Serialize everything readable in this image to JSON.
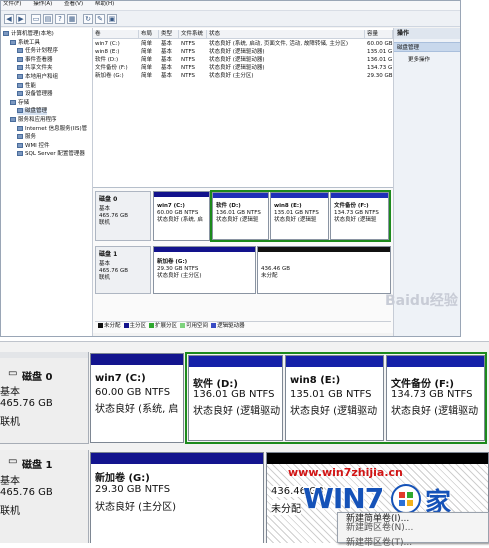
{
  "menu": [
    "文件(F)",
    "操作(A)",
    "查看(V)",
    "帮助(H)"
  ],
  "tree": [
    {
      "label": "计算机管理(本地)",
      "indent": 0
    },
    {
      "label": "系统工具",
      "indent": 1
    },
    {
      "label": "任务计划程序",
      "indent": 2
    },
    {
      "label": "事件查看器",
      "indent": 2
    },
    {
      "label": "共享文件夹",
      "indent": 2
    },
    {
      "label": "本地用户和组",
      "indent": 2
    },
    {
      "label": "性能",
      "indent": 2
    },
    {
      "label": "设备管理器",
      "indent": 2
    },
    {
      "label": "存储",
      "indent": 1
    },
    {
      "label": "磁盘管理",
      "indent": 2
    },
    {
      "label": "服务和应用程序",
      "indent": 1
    },
    {
      "label": "Internet 信息服务(IIS)管",
      "indent": 2
    },
    {
      "label": "服务",
      "indent": 2
    },
    {
      "label": "WMI 控件",
      "indent": 2
    },
    {
      "label": "SQL Server 配置管理器",
      "indent": 2
    }
  ],
  "volume_table": {
    "columns": [
      "卷",
      "布局",
      "类型",
      "文件系统",
      "状态",
      "容量"
    ],
    "rows": [
      [
        "win7 (C:)",
        "简单",
        "基本",
        "NTFS",
        "状态良好 (系统, 启动, 页面文件, 活动, 故障转储, 主分区)",
        "60.00 GB"
      ],
      [
        "win8 (E:)",
        "简单",
        "基本",
        "NTFS",
        "状态良好 (逻辑驱动器)",
        "135.01 G"
      ],
      [
        "软件 (D:)",
        "简单",
        "基本",
        "NTFS",
        "状态良好 (逻辑驱动器)",
        "136.01 G"
      ],
      [
        "文件备份 (F:)",
        "简单",
        "基本",
        "NTFS",
        "状态良好 (逻辑驱动器)",
        "134.73 G"
      ],
      [
        "新加卷 (G:)",
        "简单",
        "基本",
        "NTFS",
        "状态良好 (主分区)",
        "29.30 GB"
      ]
    ]
  },
  "actions": {
    "title": "操作",
    "selected": "磁盘管理",
    "more": "更多操作"
  },
  "disks": [
    {
      "name": "磁盘 0",
      "type": "基本",
      "size": "465.76 GB",
      "status": "联机",
      "partitions": [
        {
          "name": "win7 (C:)",
          "size": "60.00 GB NTFS",
          "status_small": "状态良好 (系统, 启",
          "status_big": "状态良好 (系统, 启"
        },
        {
          "name": "软件 (D:)",
          "size": "136.01 GB NTFS",
          "status_small": "状态良好 (逻辑驱",
          "status_big": "状态良好 (逻辑驱动"
        },
        {
          "name": "win8 (E:)",
          "size": "135.01 GB NTFS",
          "status_small": "状态良好 (逻辑驱",
          "status_big": "状态良好 (逻辑驱动"
        },
        {
          "name": "文件备份 (F:)",
          "size": "134.73 GB NTFS",
          "status_small": "状态良好 (逻辑驱",
          "status_big": "状态良好 (逻辑驱动"
        }
      ]
    },
    {
      "name": "磁盘 1",
      "type": "基本",
      "size": "465.76 GB",
      "status": "联机",
      "partitions": [
        {
          "name": "新加卷 (G:)",
          "size": "29.30 GB NTFS",
          "status_small": "状态良好 (主分区)",
          "status_big": "状态良好 (主分区)"
        },
        {
          "name": "",
          "size": "436.46 GB",
          "status_small": "未分配",
          "status_big": "未分配"
        }
      ]
    }
  ],
  "legend": [
    {
      "label": "未分配",
      "color": "#111111"
    },
    {
      "label": "主分区",
      "color": "#12128c"
    },
    {
      "label": "扩展分区",
      "color": "#2fa82f"
    },
    {
      "label": "可用空间",
      "color": "#7ed37e"
    },
    {
      "label": "逻辑驱动器",
      "color": "#3a4cc4"
    }
  ],
  "zoom_disk_labels": [
    {
      "name": "磁盘 0",
      "type": "基本",
      "size": "465.76 GB",
      "status": "联机"
    },
    {
      "name": "磁盘 1",
      "type": "基本",
      "size": "465.76 GB",
      "status": "联机"
    }
  ],
  "zoom_unalloc_size": "436.46 GB",
  "zoom_unalloc_status": "未分配",
  "context_menu": [
    "新建简单卷(I)...",
    "新建跨区卷(N)...",
    "新建带区卷(T)..."
  ],
  "watermark": {
    "site": "www.win7zhijia.cn",
    "brand": "WIN7",
    "brand_tail": "家",
    "baidu": "Baidu经验"
  },
  "colors": {
    "primary_bar": "#12128c",
    "unallocated_bar": "#000000",
    "extended_border": "#1c8a1c"
  }
}
